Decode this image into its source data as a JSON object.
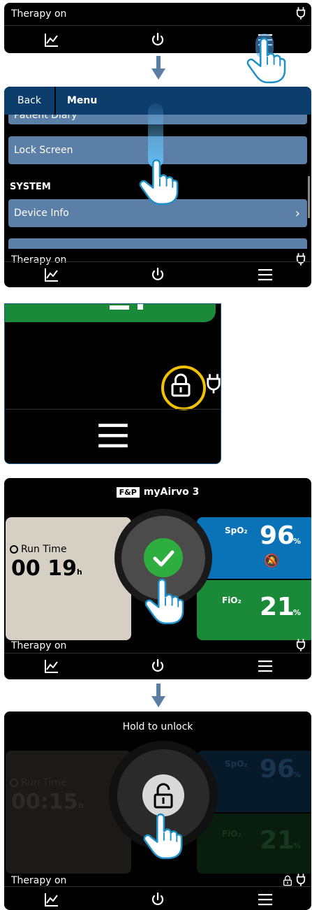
{
  "status_text": "Therapy on",
  "menu": {
    "back_label": "Back",
    "title": "Menu",
    "partial_item": "Patient Diary",
    "lock_item": "Lock Screen",
    "section_header": "SYSTEM",
    "device_info": "Device Info"
  },
  "main": {
    "brand_logo": "F&P",
    "brand_name": "myAirvo 3",
    "run_time_label": "Run Time",
    "run_time_value": "00 19",
    "run_time_unit": "h",
    "spo2_label": "SpO₂",
    "spo2_value": "96",
    "spo2_unit": "%",
    "fio2_label": "FiO₂",
    "fio2_value": "21",
    "fio2_unit": "%"
  },
  "unlock": {
    "hold_text": "Hold to unlock",
    "run_time_label": "Run Time",
    "run_time_value": "00:15",
    "run_time_unit": "h",
    "spo2_label": "SpO₂",
    "spo2_value": "96",
    "spo2_unit": "%",
    "fio2_label": "FiO₂",
    "fio2_value": "21",
    "fio2_unit": "%"
  },
  "icons": {
    "chart": "chart-icon",
    "power": "power-icon",
    "menu": "hamburger-menu-icon",
    "plug": "plug-icon",
    "lock": "lock-icon",
    "unlock": "unlock-icon",
    "check": "check-icon",
    "hand": "hand-pointer-icon",
    "arrow": "arrow-down-icon",
    "clock": "clock-icon",
    "alarm_off": "alarm-off-icon"
  },
  "colors": {
    "menu_header": "#0d3d6b",
    "menu_row": "#5b7fa6",
    "run_time_bg": "#d6d0c4",
    "spo2_bg": "#0a73b8",
    "fio2_bg": "#1a8a38",
    "check_green": "#2eae3e",
    "highlight_ring": "#f2c200",
    "arrow": "#5c7ea3"
  }
}
